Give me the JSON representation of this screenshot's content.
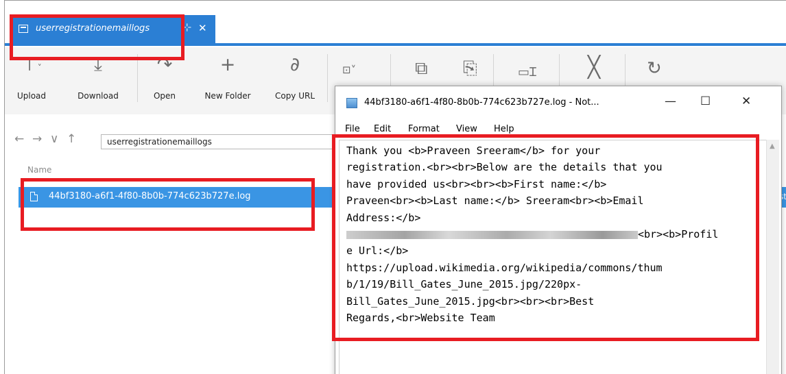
{
  "explorer": {
    "tab": {
      "title": "userregistrationemaillogs",
      "pin_icon": "pin-icon",
      "close_icon": "close-icon"
    },
    "toolbar": [
      {
        "id": "upload",
        "label": "Upload",
        "icon": "upload-icon",
        "glyph": "⊤˅"
      },
      {
        "id": "download",
        "label": "Download",
        "icon": "download-icon",
        "glyph": "↓"
      },
      {
        "id": "open",
        "label": "Open",
        "icon": "open-icon",
        "glyph": "↷"
      },
      {
        "id": "new_folder",
        "label": "New Folder",
        "icon": "plus-icon",
        "glyph": "+"
      },
      {
        "id": "copy_url",
        "label": "Copy URL",
        "icon": "link-icon",
        "glyph": "⌀"
      }
    ],
    "nav": {
      "back": "←",
      "forward": "→",
      "dropdown": "∨",
      "up": "↑",
      "path": "userregistrationemaillogs"
    },
    "columns": {
      "name": "Name"
    },
    "files": [
      {
        "name": "44bf3180-a6f1-4f80-8b0b-774c623b727e.log",
        "extra": "et-st"
      }
    ]
  },
  "notepad": {
    "title": "44bf3180-a6f1-4f80-8b0b-774c623b727e.log - Not...",
    "controls": {
      "minimize": "—",
      "maximize": "☐",
      "close": "✕"
    },
    "menu": [
      "File",
      "Edit",
      "Format",
      "View",
      "Help"
    ],
    "lines": [
      "Thank you <b>Praveen Sreeram</b> for your",
      "registration.<br><br>Below are the details that you",
      "have provided us<br><br><b>First name:</b>",
      "Praveen<br><b>Last name:</b> Sreeram<br><b>Email",
      "Address:</b>",
      "<br><b>Profil",
      "e Url:</b>",
      "https://upload.wikimedia.org/wikipedia/commons/thum",
      "b/1/19/Bill_Gates_June_2015.jpg/220px-",
      "Bill_Gates_June_2015.jpg<br><br><br>Best",
      "Regards,<br>Website Team"
    ]
  },
  "colors": {
    "accent": "#2b7fd4",
    "selection": "#3a95e4",
    "highlight": "#e81c22"
  }
}
